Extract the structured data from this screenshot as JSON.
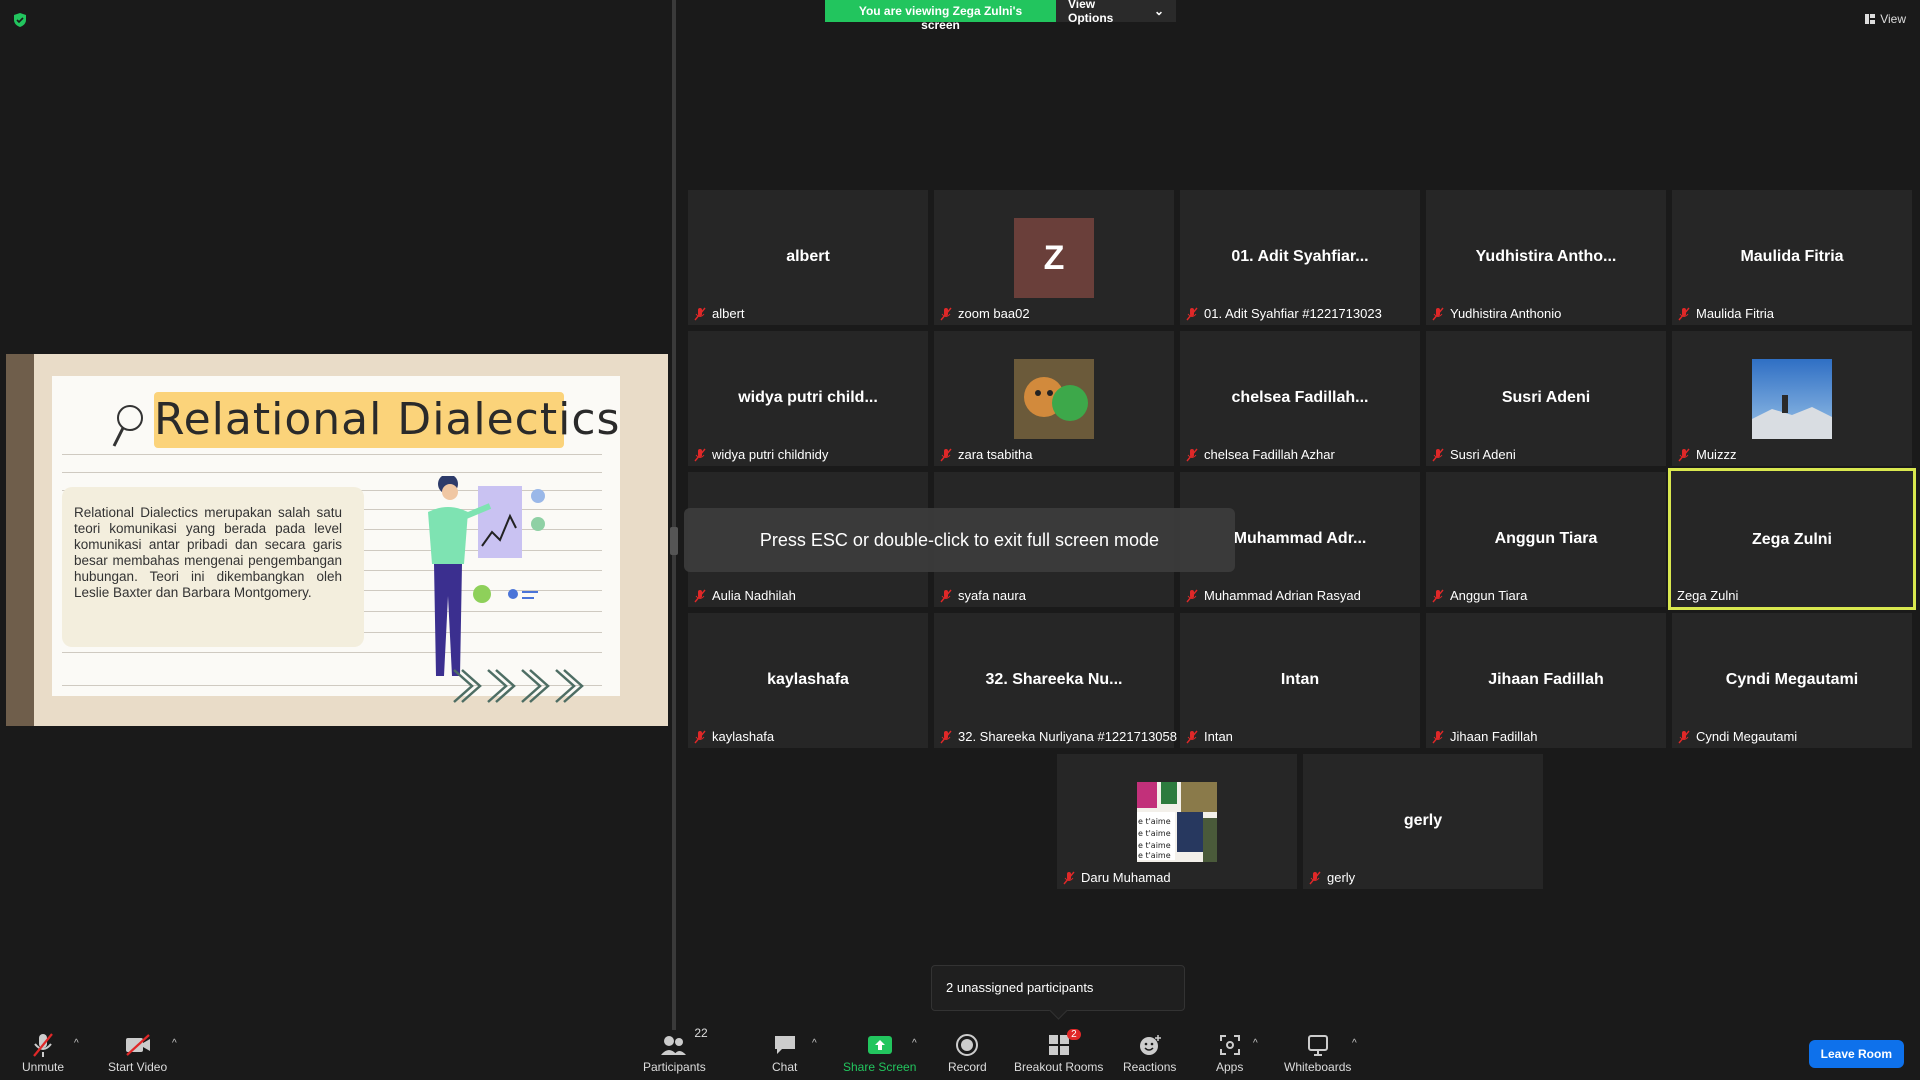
{
  "banner": {
    "viewing_text": "You are viewing Zega Zulni's screen",
    "view_options": "View Options"
  },
  "top_right": {
    "view_label": "View"
  },
  "slide": {
    "title": "Relational Dialectics",
    "body": "Relational Dialectics merupakan salah satu teori komunikasi yang berada pada level komunikasi antar pribadi dan secara garis besar membahas mengenai pengembangan hubungan. Teori ini dikembangkan oleh Leslie Baxter dan Barbara Montgomery."
  },
  "tiles": [
    {
      "name": "albert",
      "label": "albert"
    },
    {
      "name": "",
      "label": "zoom baa02",
      "avatar_letter": "Z"
    },
    {
      "name": "01. Adit Syahfiar...",
      "label": "01. Adit Syahfiar #1221713023"
    },
    {
      "name": "Yudhistira Antho...",
      "label": "Yudhistira Anthonio"
    },
    {
      "name": "Maulida Fitria",
      "label": "Maulida Fitria"
    },
    {
      "name": "widya putri child...",
      "label": "widya putri childnidy"
    },
    {
      "name": "",
      "label": "zara tsabitha"
    },
    {
      "name": "chelsea Fadillah...",
      "label": "chelsea Fadillah Azhar"
    },
    {
      "name": "Susri Adeni",
      "label": "Susri Adeni"
    },
    {
      "name": "",
      "label": "Muizzz"
    },
    {
      "name": "",
      "label": "Aulia Nadhilah"
    },
    {
      "name": "",
      "label": "syafa naura"
    },
    {
      "name": "Muhammad Adr...",
      "label": "Muhammad Adrian Rasyad"
    },
    {
      "name": "Anggun Tiara",
      "label": "Anggun Tiara"
    },
    {
      "name": "Zega Zulni",
      "label": "Zega Zulni"
    },
    {
      "name": "kaylashafa",
      "label": "kaylashafa"
    },
    {
      "name": "32. Shareeka Nu...",
      "label": "32. Shareeka Nurliyana #1221713058"
    },
    {
      "name": "Intan",
      "label": "Intan"
    },
    {
      "name": "Jihaan Fadillah",
      "label": "Jihaan Fadillah"
    },
    {
      "name": "Cyndi Megautami",
      "label": "Cyndi Megautami"
    },
    {
      "name": "",
      "label": "Daru Muhamad"
    },
    {
      "name": "gerly",
      "label": "gerly"
    }
  ],
  "esc_message": "Press ESC or double-click to exit full screen mode",
  "unassigned": "2 unassigned participants",
  "toolbar": {
    "unmute": "Unmute",
    "start_video": "Start Video",
    "participants": "Participants",
    "participants_count": "22",
    "chat": "Chat",
    "share_screen": "Share Screen",
    "record": "Record",
    "breakout_rooms": "Breakout Rooms",
    "breakout_badge": "2",
    "reactions": "Reactions",
    "apps": "Apps",
    "whiteboards": "Whiteboards",
    "leave_room": "Leave Room"
  },
  "colors": {
    "share_green": "#22c55e",
    "active_border": "#d9e84f",
    "leave_blue": "#0e71eb",
    "muted_red": "#e02828"
  }
}
